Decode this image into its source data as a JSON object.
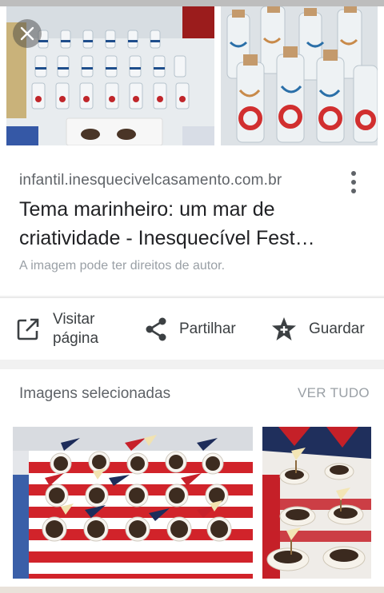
{
  "result": {
    "domain": "infantil.inesquecivelcasamento.com.br",
    "title": "Tema marinheiro: um mar de criatividade - Inesquecível Fest…",
    "rights_notice": "A imagem pode ter direitos de autor."
  },
  "actions": {
    "visit_label_line1": "Visitar",
    "visit_label_line2": "página",
    "share_label": "Partilhar",
    "save_label": "Guardar"
  },
  "selected": {
    "heading": "Imagens selecionadas",
    "see_all": "VER TUDO"
  },
  "icons": {
    "close": "close-icon",
    "more": "more-vert-icon",
    "visit": "open-in-new-icon",
    "share": "share-icon",
    "save": "star-add-icon"
  },
  "colors": {
    "text_primary": "#202124",
    "text_secondary": "#5f6368",
    "text_muted": "#9aa0a6",
    "background": "#f1f1f1"
  }
}
